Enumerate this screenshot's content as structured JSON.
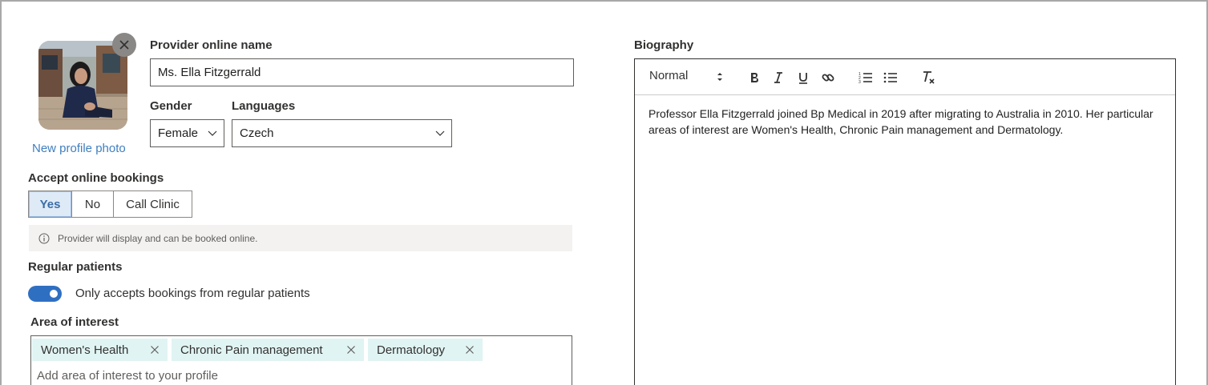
{
  "profile": {
    "new_photo_label": "New profile photo",
    "photo_alt": "Provider profile photo"
  },
  "fields": {
    "online_name_label": "Provider online name",
    "online_name_value": "Ms. Ella Fitzgerrald",
    "gender_label": "Gender",
    "gender_value": "Female",
    "languages_label": "Languages",
    "languages_value": "Czech"
  },
  "bookings": {
    "label": "Accept online bookings",
    "options": [
      "Yes",
      "No",
      "Call Clinic"
    ],
    "selected": "Yes",
    "info_text": "Provider will display and can be booked online."
  },
  "regular_patients": {
    "label": "Regular patients",
    "toggle_on": true,
    "toggle_text": "Only accepts bookings from regular patients"
  },
  "area_of_interest": {
    "label": "Area of interest",
    "tags": [
      "Women's Health",
      "Chronic Pain management",
      "Dermatology"
    ],
    "placeholder": "Add area of interest to your profile"
  },
  "biography": {
    "label": "Biography",
    "format_select": "Normal",
    "toolbar_icons": [
      "bold-icon",
      "italic-icon",
      "underline-icon",
      "link-icon",
      "ordered-list-icon",
      "bullet-list-icon",
      "clear-format-icon"
    ],
    "text": "Professor Ella Fitzgerrald joined Bp Medical in 2019 after migrating to Australia in 2010. Her particular areas of interest are Women's Health, Chronic Pain management and Dermatology."
  },
  "colors": {
    "accent": "#2f6fc2",
    "link": "#3f7fbf",
    "tag_bg": "#e0f4f3",
    "selected_segment_bg": "#dfeaf7"
  }
}
